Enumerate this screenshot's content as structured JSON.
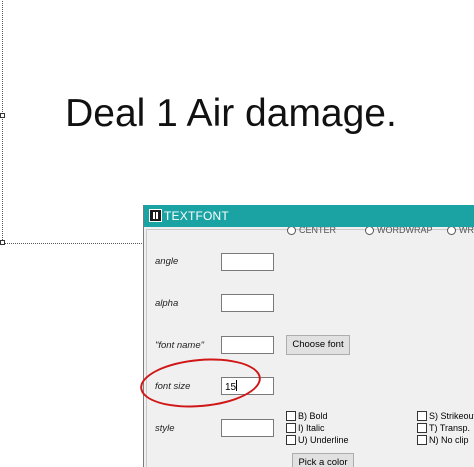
{
  "canvas": {
    "text": "Deal 1 Air damage."
  },
  "dialog": {
    "title": "TEXTFONT",
    "radio_options": [
      "CENTER",
      "WORDWRAP",
      "WRAP"
    ],
    "fields": [
      {
        "label": "angle",
        "value": ""
      },
      {
        "label": "alpha",
        "value": ""
      },
      {
        "label": "\"font name\"",
        "value": ""
      },
      {
        "label": "font size",
        "value": "15"
      },
      {
        "label": "style",
        "value": ""
      }
    ],
    "choose_font_label": "Choose font",
    "pick_color_label": "Pick a color",
    "style_options": {
      "left": [
        "B) Bold",
        "I) Italic",
        "U) Underline"
      ],
      "right": [
        "S) Strikeout",
        "T) Transp.",
        "N) No clip"
      ]
    }
  },
  "annotation": {
    "color": "#d01616"
  }
}
